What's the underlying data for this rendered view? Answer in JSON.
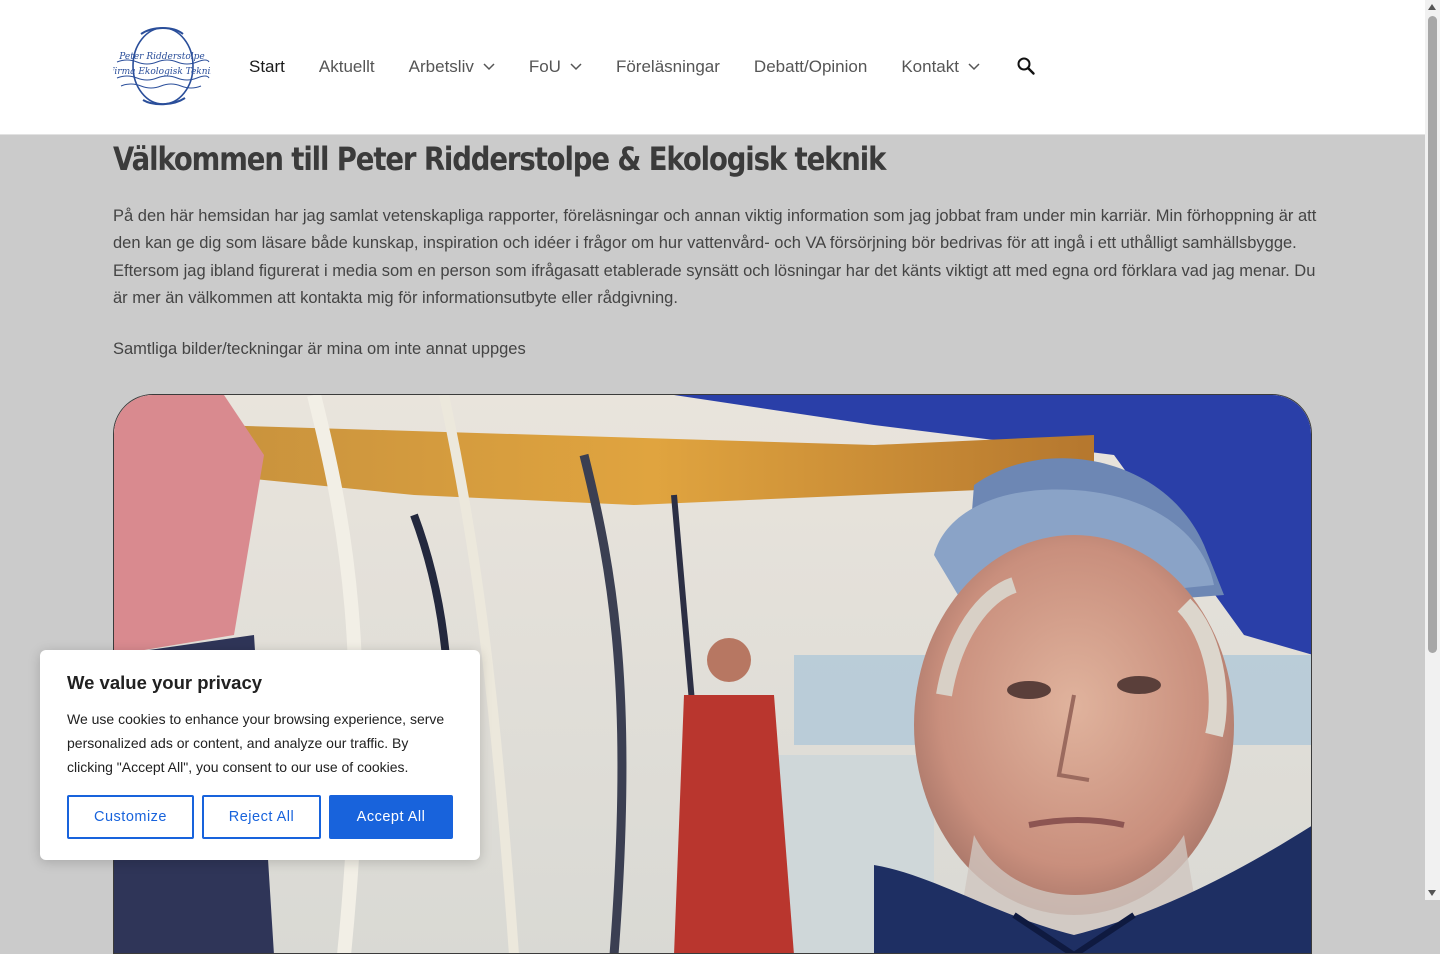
{
  "header": {
    "nav": [
      {
        "label": "Start",
        "active": true,
        "dropdown": false
      },
      {
        "label": "Aktuellt",
        "active": false,
        "dropdown": false
      },
      {
        "label": "Arbetsliv",
        "active": false,
        "dropdown": true
      },
      {
        "label": "FoU",
        "active": false,
        "dropdown": true
      },
      {
        "label": "Föreläsningar",
        "active": false,
        "dropdown": false
      },
      {
        "label": "Debatt/Opinion",
        "active": false,
        "dropdown": false
      },
      {
        "label": "Kontakt",
        "active": false,
        "dropdown": true
      }
    ],
    "search_icon": "search-icon",
    "logo_text_line1": "Peter Ridderstolpe",
    "logo_text_line2": "Firma Ekologisk Teknik"
  },
  "main": {
    "title": "Välkommen till Peter Ridderstolpe & Ekologisk teknik",
    "intro": "På den här hemsidan har jag samlat vetenskapliga rapporter, föreläsningar och annan viktig information som jag jobbat fram under min karriär. Min förhoppning är att den kan ge dig som läsare både kunskap, inspiration och idéer i frågor om hur vattenvård- och VA försörjning bör bedrivas för att ingå i ett uthålligt samhällsbygge. Eftersom jag ibland figurerat i media som en person som ifrågasatt etablerade synsätt och lösningar har det känts viktigt att med egna ord förklara vad jag menar. Du är mer än välkommen att kontakta mig för informationsutbyte eller rådgivning.",
    "note": "Samtliga bilder/teckningar är mina om inte annat uppges"
  },
  "cookie": {
    "title": "We value your privacy",
    "text": "We use cookies to enhance your browsing experience, serve personalized ads or content, and analyze our traffic. By clicking \"Accept All\", you consent to our use of cookies.",
    "customize": "Customize",
    "reject": "Reject All",
    "accept": "Accept All"
  },
  "colors": {
    "accent": "#1863dc",
    "page_bg": "#cbcbcb",
    "header_bg": "#ffffff"
  }
}
